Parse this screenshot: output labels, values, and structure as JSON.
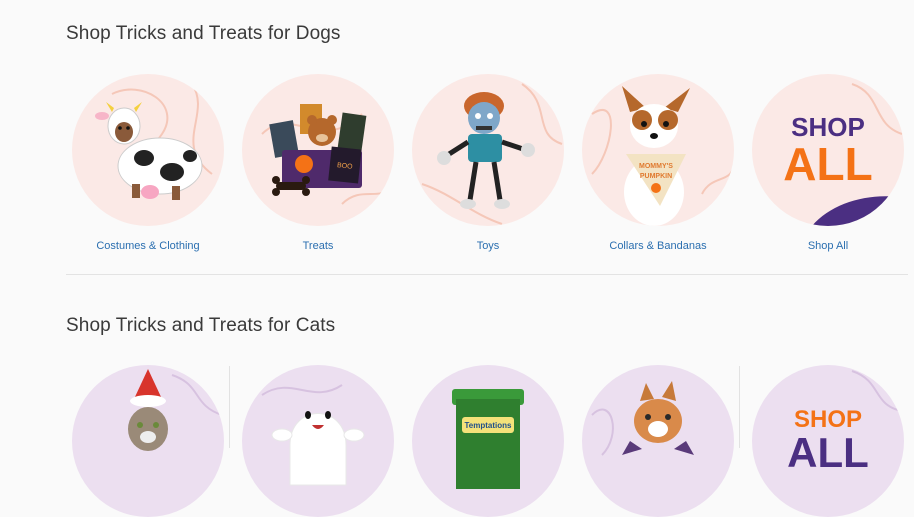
{
  "dogs": {
    "title": "Shop Tricks and Treats for Dogs",
    "tiles": [
      {
        "label": "Costumes & Clothing",
        "icon": "dog-cow-costume-image"
      },
      {
        "label": "Treats",
        "icon": "treat-basket-image"
      },
      {
        "label": "Toys",
        "icon": "zombie-rope-toy-image"
      },
      {
        "label": "Collars & Bandanas",
        "icon": "dog-bandana-image"
      },
      {
        "label": "Shop All",
        "icon": "shop-all-graphic"
      }
    ],
    "shop_all_line1": "SHOP",
    "shop_all_line2": "ALL",
    "bandana_text_1": "MOMMY'S",
    "bandana_text_2": "PUMPKIN"
  },
  "cats": {
    "title": "Shop Tricks and Treats for Cats",
    "tiles": [
      {
        "icon": "cat-gnome-hat-image"
      },
      {
        "icon": "ghost-plush-toy-image"
      },
      {
        "icon": "temptations-treat-tub-image"
      },
      {
        "icon": "cat-costume-image"
      },
      {
        "icon": "shop-all-graphic"
      }
    ],
    "tub_brand": "Temptations",
    "shop_all_line1": "SHOP",
    "shop_all_line2": "ALL"
  },
  "colors": {
    "dog_circle_bg": "#fbe9e6",
    "cat_circle_bg": "#ecdff0",
    "shop_purple": "#4b2f82",
    "shop_orange": "#f47216",
    "link_blue": "#2b6fb0"
  }
}
